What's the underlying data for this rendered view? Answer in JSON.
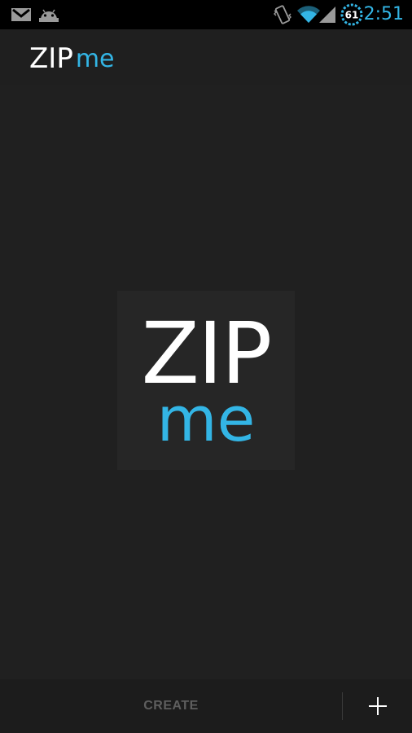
{
  "status_bar": {
    "time": "2:51",
    "battery_level": "61",
    "icons": [
      "gmail-icon",
      "android-debug-icon",
      "vibrate-icon",
      "wifi-icon",
      "signal-icon",
      "battery-icon"
    ]
  },
  "action_bar": {
    "logo_zip": "ZIP",
    "logo_me": "me"
  },
  "center_logo": {
    "zip": "ZIP",
    "me": "me"
  },
  "bottom_bar": {
    "create_label": "CREATE",
    "add_icon": "plus-icon"
  },
  "colors": {
    "accent": "#33b5e5",
    "background": "#202020",
    "status_bar": "#000000",
    "disabled_text": "#5e5e5e"
  }
}
